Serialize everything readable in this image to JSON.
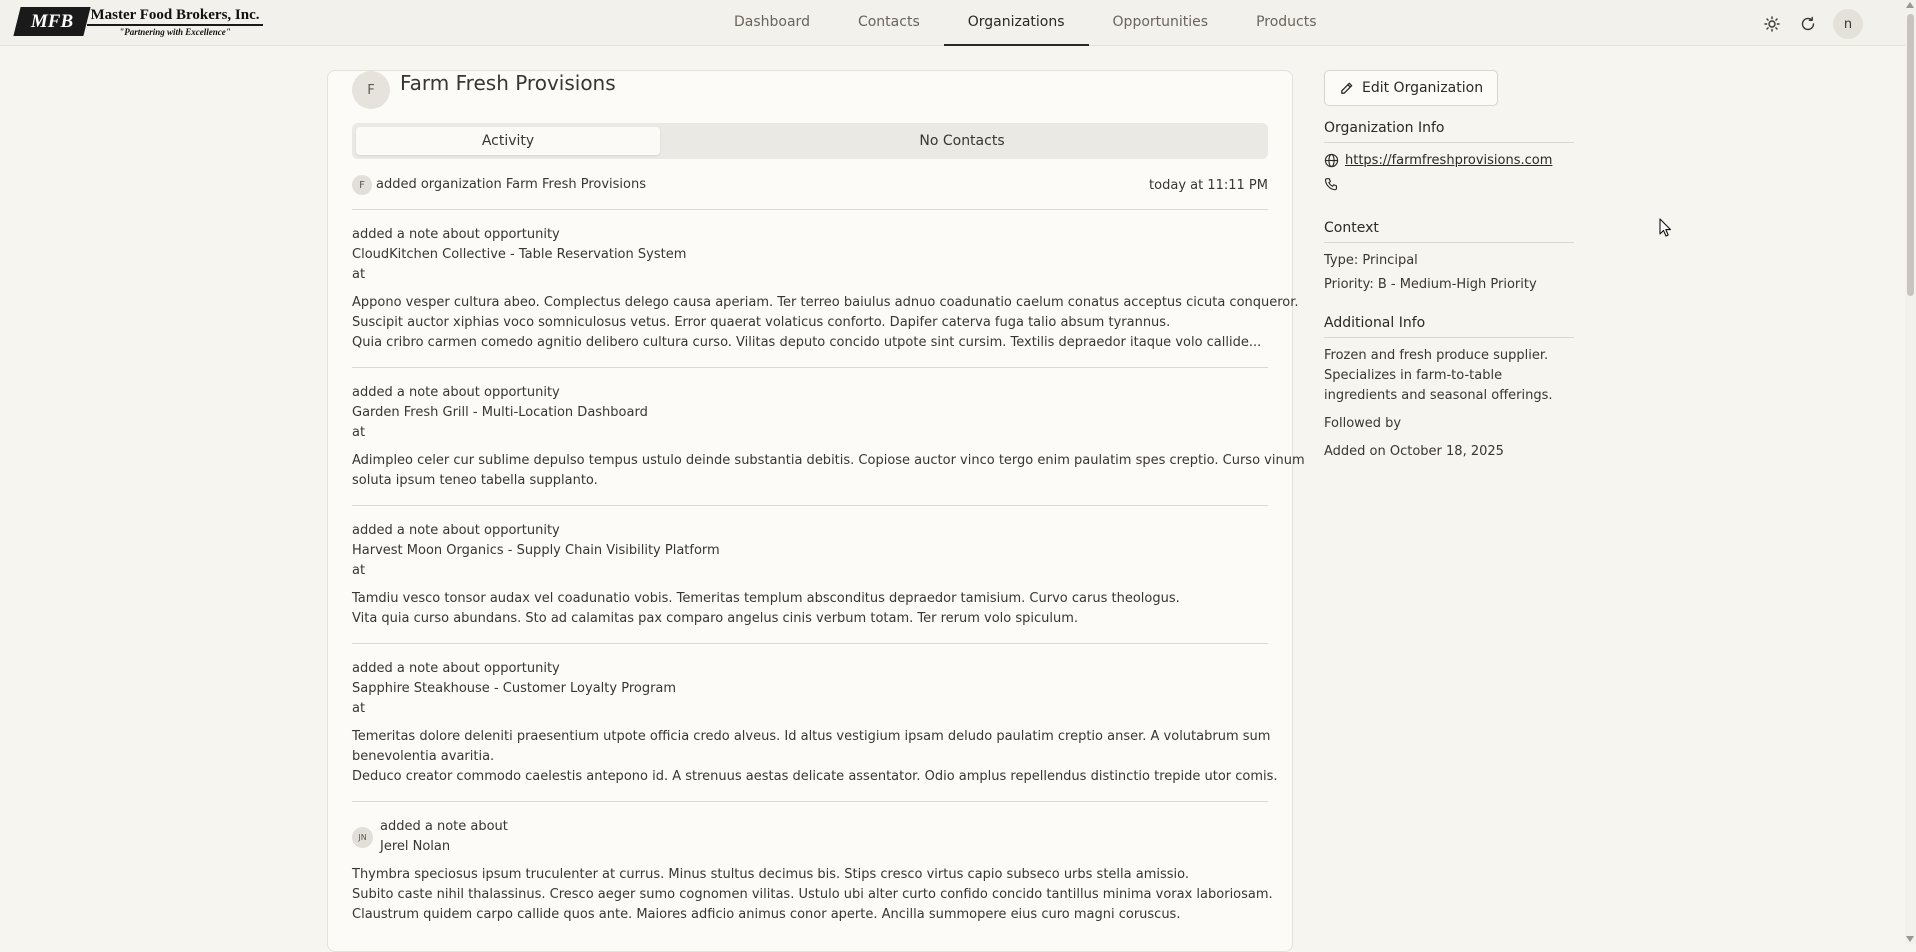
{
  "brand": {
    "mark": "MFB",
    "name": "Master Food Brokers, Inc.",
    "tagline": "\"Partnering with Excellence\""
  },
  "nav": {
    "tabs": [
      {
        "label": "Dashboard"
      },
      {
        "label": "Contacts"
      },
      {
        "label": "Organizations",
        "active": true
      },
      {
        "label": "Opportunities"
      },
      {
        "label": "Products"
      }
    ]
  },
  "header_icons": [
    "sun-icon",
    "refresh-icon"
  ],
  "user": {
    "initial": "n"
  },
  "organization": {
    "initial": "F",
    "name": "Farm Fresh Provisions"
  },
  "tabs": {
    "activity": "Activity",
    "contacts": "No Contacts"
  },
  "feed": {
    "first": {
      "avatar": "F",
      "text": "added organization Farm Fresh Provisions",
      "time": "today at 11:11 PM"
    },
    "notes": [
      {
        "action": "added a note about opportunity",
        "subject": "CloudKitchen Collective - Table Reservation System",
        "at": "at",
        "body": [
          "Appono vesper cultura abeo. Complectus delego causa aperiam. Ter terreo baiulus adnuo coadunatio caelum conatus acceptus cicuta conqueror.",
          "Suscipit auctor xiphias voco somniculosus vetus. Error quaerat volaticus conforto. Dapifer caterva fuga talio absum tyrannus.",
          "Quia cribro carmen comedo agnitio delibero cultura curso. Vilitas deputo concido utpote sint cursim. Textilis depraedor itaque volo callide..."
        ]
      },
      {
        "action": "added a note about opportunity",
        "subject": "Garden Fresh Grill - Multi-Location Dashboard",
        "at": "at",
        "body": [
          "Adimpleo celer cur sublime depulso tempus ustulo deinde substantia debitis. Copiose auctor vinco tergo enim paulatim spes creptio. Curso vinum",
          "soluta ipsum teneo tabella supplanto."
        ]
      },
      {
        "action": "added a note about opportunity",
        "subject": "Harvest Moon Organics - Supply Chain Visibility Platform",
        "at": "at",
        "body": [
          "Tamdiu vesco tonsor audax vel coadunatio vobis. Temeritas templum absconditus depraedor tamisium. Curvo carus theologus.",
          "Vita quia curso abundans. Sto ad calamitas pax comparo angelus cinis verbum totam. Ter rerum volo spiculum."
        ]
      },
      {
        "action": "added a note about opportunity",
        "subject": "Sapphire Steakhouse - Customer Loyalty Program",
        "at": "at",
        "body": [
          "Temeritas dolore deleniti praesentium utpote officia credo alveus. Id altus vestigium ipsam deludo paulatim creptio anser. A volutabrum sum",
          "benevolentia avaritia.",
          "Deduco creator commodo caelestis antepono id. A strenuus aestas delicate assentator. Odio amplus repellendus distinctio trepide utor comis."
        ]
      }
    ],
    "last": {
      "avatar": "JN",
      "action": "added a note about",
      "subject": "Jerel Nolan",
      "body": [
        "Thymbra speciosus ipsum truculenter at currus. Minus stultus decimus bis. Stips cresco virtus capio subseco urbs stella amissio.",
        "Subito caste nihil thalassinus. Cresco aeger sumo cognomen vilitas. Ustulo ubi alter curto confido concido tantillus minima vorax laboriosam.",
        "Claustrum quidem carpo callide quos ante. Maiores adficio animus conor aperte. Ancilla summopere eius curo magni coruscus."
      ]
    }
  },
  "sidebar": {
    "edit_label": "Edit Organization",
    "info_title": "Organization Info",
    "website": "https://farmfreshprovisions.com",
    "context_title": "Context",
    "type": "Type: Principal",
    "priority": "Priority: B - Medium-High Priority",
    "additional_title": "Additional Info",
    "description": "Frozen and fresh produce supplier. Specializes in farm-to-table ingredients and seasonal offerings.",
    "followed_by": "Followed by",
    "added_on": "Added on October 18, 2025"
  }
}
